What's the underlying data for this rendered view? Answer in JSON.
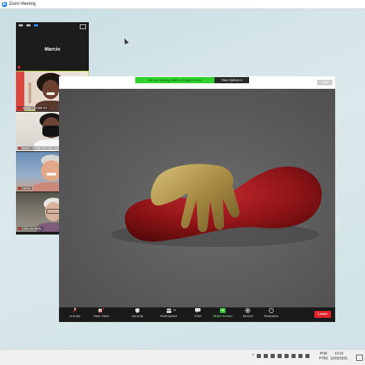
{
  "window": {
    "title": "Zoom Meeting"
  },
  "gallery": {
    "speaker": "Marcio",
    "participants": [
      {
        "label": "Janine - CCBB RJ",
        "active": true
      },
      {
        "label": "Dean - CCBB RIO DE JANE",
        "active": false
      },
      {
        "label": "carina",
        "active": false
      },
      {
        "label": "Célia de Mello",
        "active": false
      }
    ]
  },
  "share": {
    "banner": "You are viewing Valéria Chagas screen",
    "view_options": "View Options",
    "view_button": "View"
  },
  "toolbar": {
    "unmute": "Unmute",
    "start_video": "Start Video",
    "security": "Security",
    "participants": "Participants",
    "participants_count": "15",
    "chat": "Chat",
    "share_screen": "Share Screen",
    "record": "Record",
    "reactions": "Reactions",
    "leave": "Leave"
  },
  "taskbar": {
    "language": "POR",
    "keyboard": "PTB2",
    "time": "10:15",
    "date": "12/02/2021"
  },
  "colors": {
    "zoom_blue": "#2d8cff",
    "leave_red": "#e0242a",
    "share_green": "#2fd12f",
    "active_speaker": "#b5e04a"
  }
}
